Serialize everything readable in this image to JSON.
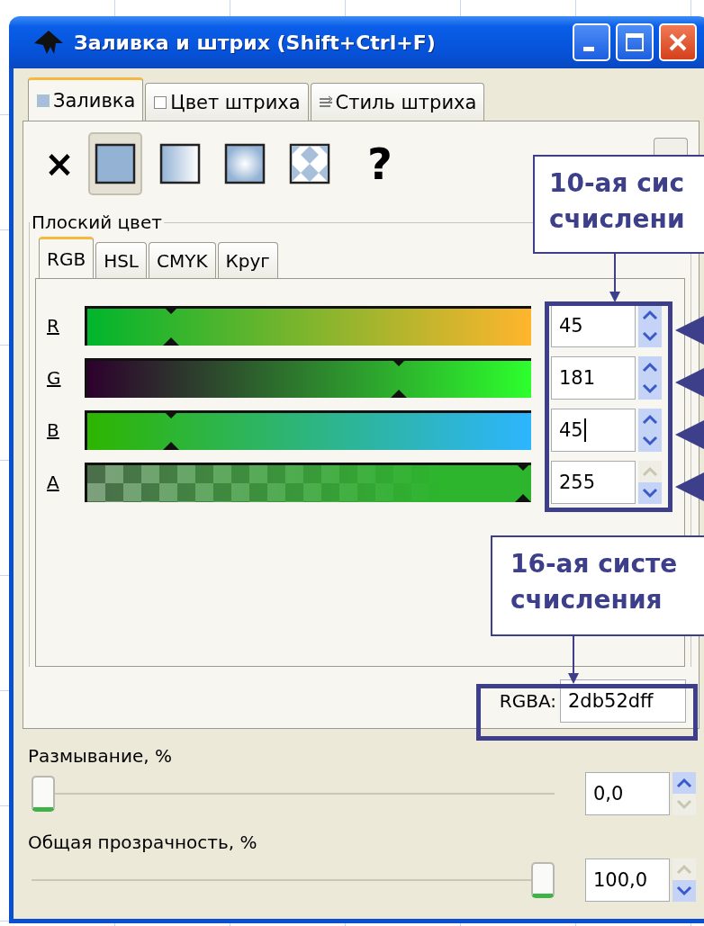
{
  "window": {
    "title": "Заливка и штрих (Shift+Ctrl+F)"
  },
  "tabs": [
    {
      "label": "Заливка",
      "selected": true
    },
    {
      "label": "Цвет штриха",
      "selected": false
    },
    {
      "label": "Стиль штриха",
      "selected": false
    }
  ],
  "paint_types": [
    {
      "kind": "none",
      "symbol": "×",
      "selected": false
    },
    {
      "kind": "flat",
      "selected": true
    },
    {
      "kind": "linear",
      "selected": false
    },
    {
      "kind": "radial",
      "selected": false
    },
    {
      "kind": "pattern",
      "selected": false
    },
    {
      "kind": "unset",
      "symbol": "?",
      "selected": false
    }
  ],
  "frame": {
    "label": "Плоский цвет"
  },
  "color_tabs": [
    {
      "label": "RGB",
      "selected": true
    },
    {
      "label": "HSL",
      "selected": false
    },
    {
      "label": "CMYK",
      "selected": false
    },
    {
      "label": "Круг",
      "selected": false
    }
  ],
  "channels": [
    {
      "label": "R",
      "kind": "red",
      "level": 0.176,
      "value": "45",
      "focused": false,
      "up_disabled": false,
      "down_disabled": false
    },
    {
      "label": "G",
      "kind": "green",
      "level": 0.71,
      "value": "181",
      "focused": false,
      "up_disabled": false,
      "down_disabled": false
    },
    {
      "label": "B",
      "kind": "blue",
      "level": 0.176,
      "value": "45",
      "focused": true,
      "up_disabled": false,
      "down_disabled": false
    },
    {
      "label": "A",
      "kind": "alpha",
      "level": 1,
      "value": "255",
      "focused": false,
      "up_disabled": true,
      "down_disabled": false
    }
  ],
  "rgba": {
    "label": "RGBA:",
    "value": "2db52dff"
  },
  "sliders": [
    {
      "label": "Размывание, %",
      "level": 0,
      "value": "0,0",
      "up_disabled": false,
      "down_disabled": true
    },
    {
      "label": "Общая прозрачность, %",
      "level": 1,
      "value": "100,0",
      "up_disabled": true,
      "down_disabled": false
    }
  ],
  "callouts": [
    {
      "lines": [
        "10-ая сис",
        "счислени"
      ]
    },
    {
      "lines": [
        "16-ая систе",
        "счисления"
      ]
    }
  ]
}
